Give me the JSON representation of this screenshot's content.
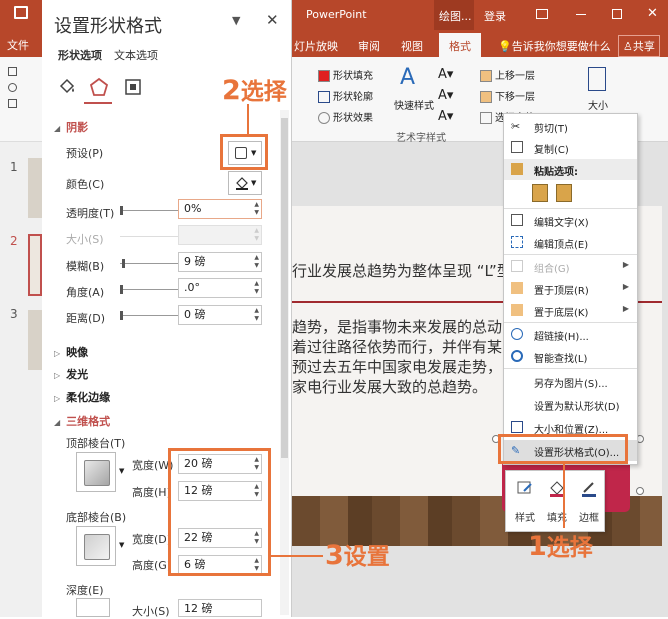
{
  "app": {
    "title": "PowerPoint",
    "drawing_tab": "绘图...",
    "login": "登录",
    "file_tab": "文件",
    "tabs": [
      "灯片放映",
      "审阅",
      "视图",
      "格式"
    ],
    "tell_me": "告诉我你想要做什么",
    "share": "共享",
    "ribbon": {
      "shape_fill": "形状填充",
      "shape_outline": "形状轮廓",
      "shape_effect": "形状效果",
      "quick_style": "快速样式",
      "art_text_group": "艺术字样式",
      "bring_forward": "上移一层",
      "send_backward": "下移一层",
      "selection_pane": "选择窗格",
      "size": "大小"
    }
  },
  "pane": {
    "title": "设置形状格式",
    "tab_shape": "形状选项",
    "tab_text": "文本选项",
    "shadow": {
      "header": "阴影",
      "preset": "预设(P)",
      "color": "颜色(C)",
      "transparency": "透明度(T)",
      "transparency_value": "0%",
      "size": "大小(S)",
      "blur": "模糊(B)",
      "blur_value": "9 磅",
      "angle": "角度(A)",
      "angle_value": ".0°",
      "distance": "距离(D)",
      "distance_value": "0 磅"
    },
    "reflection": "映像",
    "glow": "发光",
    "soft_edges": "柔化边缘",
    "three_d": {
      "header": "三维格式",
      "top_bevel": "顶部棱台(T)",
      "top_width_label": "宽度(W)",
      "top_width": "20 磅",
      "top_height_label": "高度(H)",
      "top_height": "12 磅",
      "bottom_bevel": "底部棱台(B)",
      "bottom_width_label": "宽度(D)",
      "bottom_width": "22 磅",
      "bottom_height_label": "高度(G)",
      "bottom_height": "6 磅",
      "depth": "深度(E)",
      "depth_size_label": "大小(S)",
      "depth_size": "12 磅"
    }
  },
  "thumbs": [
    "1",
    "2",
    "3"
  ],
  "slide": {
    "line1": "行业发展总趋势为整体呈现 “L”型",
    "line2": "趋势，是指事物未来发展的总动",
    "line3": "着过往路径依势而行，并伴有某",
    "line4": "预过去五年中国家电发展走势，",
    "line5": "家电行业发展大致的总趋势。"
  },
  "context_menu": {
    "cut": "剪切(T)",
    "copy": "复制(C)",
    "paste_options": "粘贴选项:",
    "edit_text": "编辑文字(X)",
    "edit_points": "编辑顶点(E)",
    "group": "组合(G)",
    "bring_front": "置于顶层(R)",
    "send_back": "置于底层(K)",
    "hyperlink": "超链接(H)...",
    "smart_lookup": "智能查找(L)",
    "save_as_picture": "另存为图片(S)...",
    "set_default": "设置为默认形状(D)",
    "size_position": "大小和位置(Z)...",
    "format_shape": "设置形状格式(O)..."
  },
  "mini_toolbar": {
    "style": "样式",
    "fill": "填充",
    "border": "边框"
  },
  "callouts": {
    "step1_num": "1",
    "step1_text": "选择",
    "step2_num": "2",
    "step2_text": "选择",
    "step3_num": "3",
    "step3_text": "设置"
  },
  "colors": {
    "accent": "#b7472a",
    "callout": "#e8743b",
    "shadow_header": "#c0504d"
  }
}
